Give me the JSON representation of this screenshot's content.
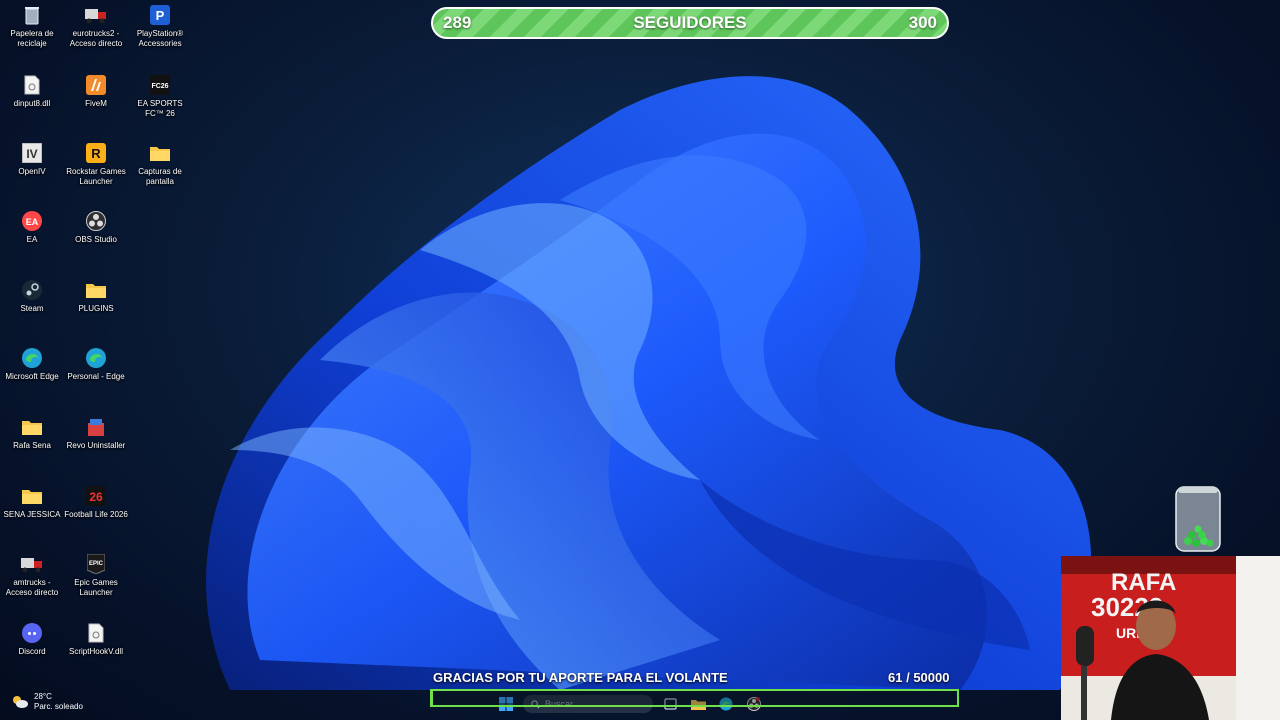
{
  "follower_goal": {
    "current": "289",
    "label": "SEGUIDORES",
    "target": "300"
  },
  "donation_goal": {
    "message": "GRACIAS POR TU APORTE PARA EL VOLANTE",
    "current": "61",
    "separator": " / ",
    "target": "50000",
    "progress_fraction": 0.0012
  },
  "desktop_icons": [
    {
      "label": "Papelera de reciclaje",
      "icon": "recycle-bin-icon"
    },
    {
      "label": "eurotrucks2 - Acceso directo",
      "icon": "truck-icon"
    },
    {
      "label": "PlayStation® Accessories",
      "icon": "playstation-icon"
    },
    {
      "label": "dinput8.dll",
      "icon": "file-icon"
    },
    {
      "label": "FiveM",
      "icon": "fivem-icon"
    },
    {
      "label": "EA SPORTS FC™ 26",
      "icon": "ea-fc-icon"
    },
    {
      "label": "OpenIV",
      "icon": "openiv-icon"
    },
    {
      "label": "Rockstar Games Launcher",
      "icon": "rockstar-icon"
    },
    {
      "label": "Capturas de pantalla",
      "icon": "folder-icon"
    },
    {
      "label": "EA",
      "icon": "ea-icon"
    },
    {
      "label": "OBS Studio",
      "icon": "obs-icon"
    },
    {
      "label": "Steam",
      "icon": "steam-icon"
    },
    {
      "label": "PLUGINS",
      "icon": "folder-icon"
    },
    {
      "label": "Microsoft Edge",
      "icon": "edge-icon"
    },
    {
      "label": "Personal - Edge",
      "icon": "edge-icon"
    },
    {
      "label": "Rafa Sena",
      "icon": "folder-icon"
    },
    {
      "label": "Revo Uninstaller",
      "icon": "revo-icon"
    },
    {
      "label": "SENA JESSICA",
      "icon": "folder-icon"
    },
    {
      "label": "Football Life 2026",
      "icon": "football-life-icon"
    },
    {
      "label": "amtrucks - Acceso directo",
      "icon": "truck-icon"
    },
    {
      "label": "Epic Games Launcher",
      "icon": "epic-games-icon"
    },
    {
      "label": "Discord",
      "icon": "discord-icon"
    },
    {
      "label": "ScriptHookV.dll",
      "icon": "file-icon"
    }
  ],
  "taskbar": {
    "search_placeholder": "Buscar",
    "weather_temp": "28°C",
    "weather_desc": "Parc. soleado"
  },
  "webcam_overlay": {
    "banner_text": "RAFA 30229",
    "banner_sub": "URBAN"
  },
  "colors": {
    "follower_bar_green": "#5ec55a",
    "goal_bar_green": "#6ee04a",
    "wallpaper_blue": "#1e5cff"
  }
}
